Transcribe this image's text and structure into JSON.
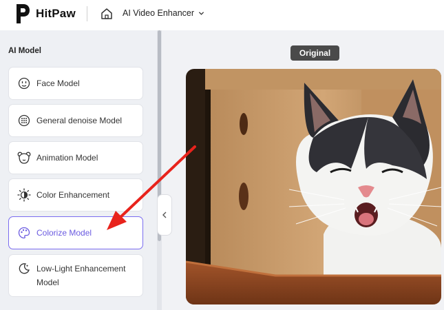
{
  "header": {
    "brand": "HitPaw",
    "app_menu_label": "AI Video Enhancer"
  },
  "sidebar": {
    "title": "AI Model",
    "items": [
      {
        "label": "Face Model",
        "icon": "face-icon",
        "active": false
      },
      {
        "label": "General denoise Model",
        "icon": "denoise-icon",
        "active": false
      },
      {
        "label": "Animation Model",
        "icon": "bear-icon",
        "active": false
      },
      {
        "label": "Color Enhancement",
        "icon": "sun-icon",
        "active": false
      },
      {
        "label": "Colorize Model",
        "icon": "palette-icon",
        "active": true
      },
      {
        "label": "Low-Light Enhancement Model",
        "icon": "moon-icon",
        "active": false
      }
    ]
  },
  "preview": {
    "badge": "Original",
    "image_subject": "cat-yawning"
  },
  "colors": {
    "accent": "#7a6cf0",
    "arrow": "#e8231c",
    "sidebar_bg": "#eef0f4",
    "main_bg": "#f1f2f5"
  }
}
